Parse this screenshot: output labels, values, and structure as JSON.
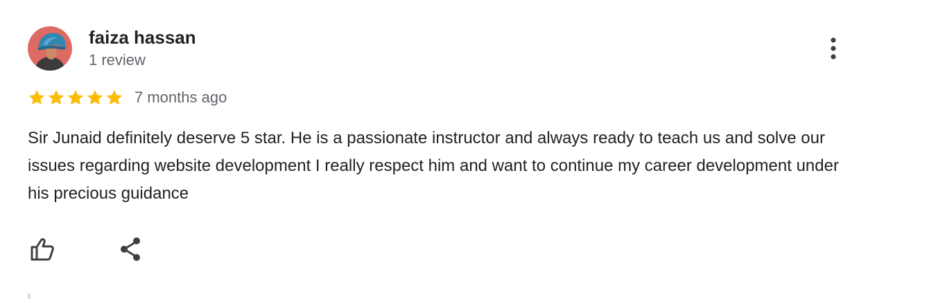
{
  "reviewer": {
    "name": "faiza hassan",
    "review_count": "1 review",
    "avatar_icon": "profile-photo"
  },
  "rating": {
    "stars": 5,
    "max_stars": 5,
    "star_color": "#fbbc04",
    "date": "7 months ago"
  },
  "review": {
    "text": "Sir Junaid definitely deserve 5 star. He is a passionate instructor and always ready to teach us and solve our issues regarding website development I really respect him and want to continue my career development under his precious guidance"
  },
  "actions": {
    "like_icon": "thumb-up-icon",
    "share_icon": "share-icon",
    "more_icon": "more-vertical-icon"
  }
}
